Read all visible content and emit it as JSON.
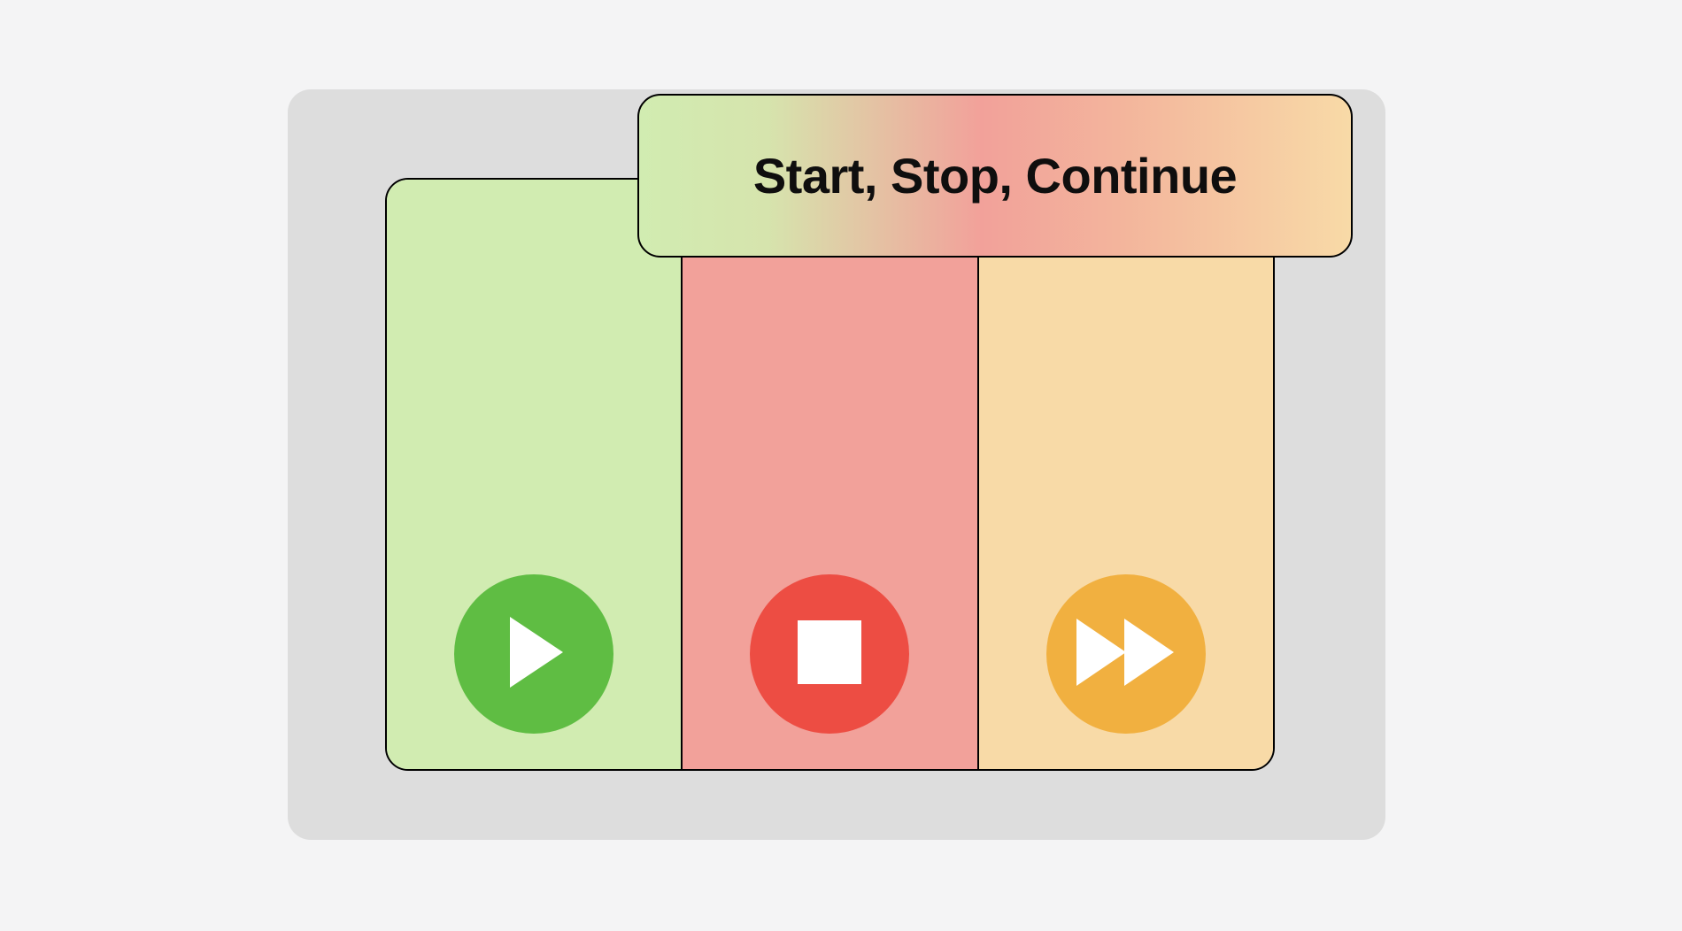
{
  "title": "Start, Stop, Continue",
  "columns": {
    "start": {
      "name": "Start"
    },
    "stop": {
      "name": "Stop"
    },
    "continue": {
      "name": "Continue"
    }
  },
  "colors": {
    "page_bg": "#f4f4f5",
    "card_bg": "#dddddd",
    "start_panel": "#d1ecb1",
    "stop_panel": "#f2a19a",
    "continue_panel": "#f8daa7",
    "start_btn": "#5fbd43",
    "stop_btn": "#ed4d43",
    "continue_btn": "#f1b040"
  }
}
